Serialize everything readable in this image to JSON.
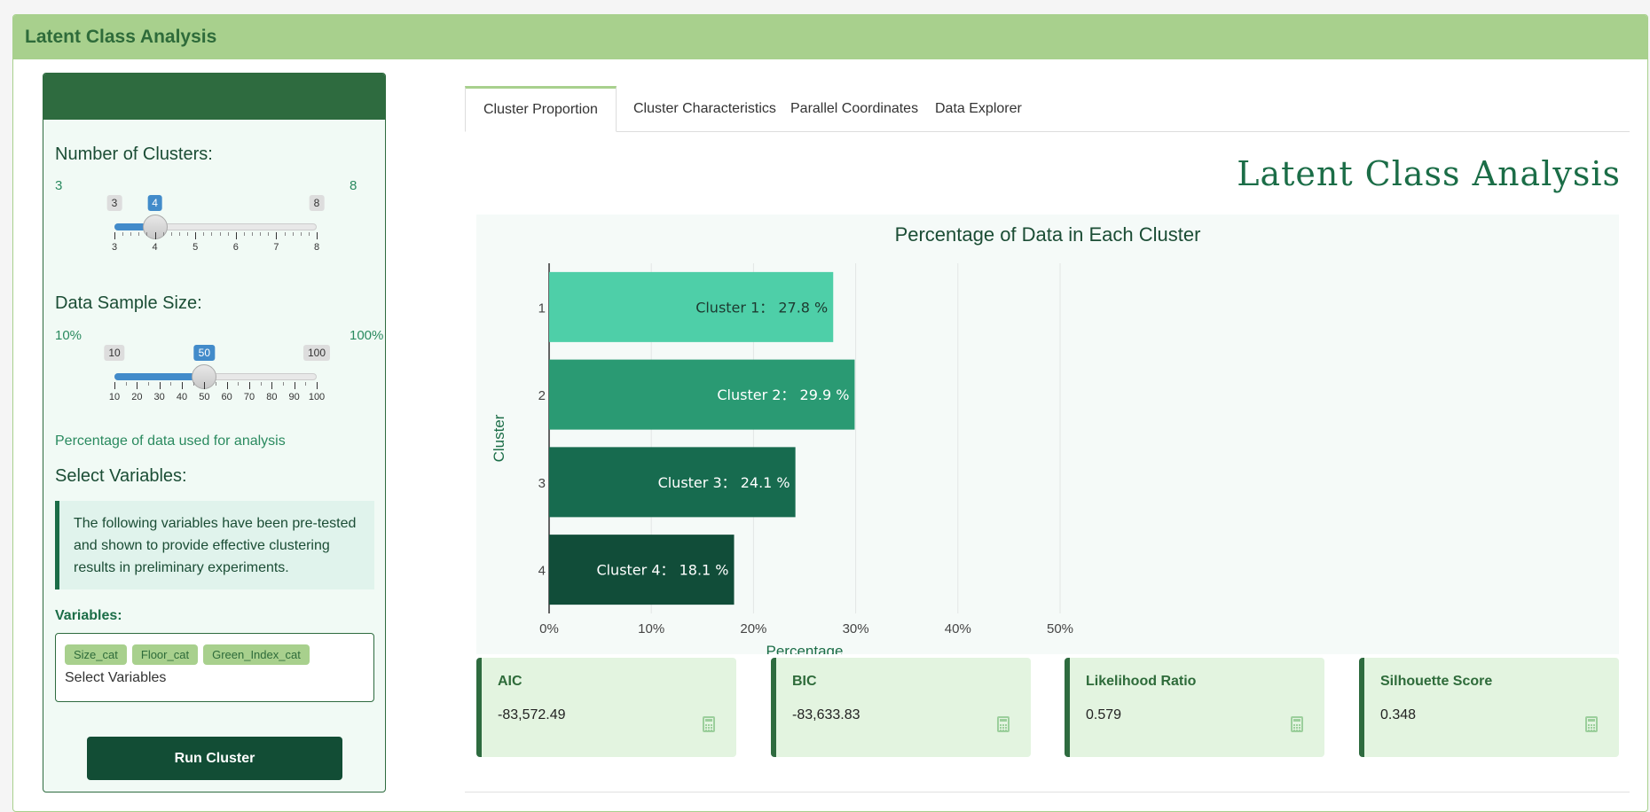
{
  "header": {
    "title": "Latent Class Analysis"
  },
  "sidebar": {
    "clusters": {
      "label": "Number of Clusters:",
      "min_label": "3",
      "max_label": "8",
      "min": 3,
      "max": 8,
      "value": 4,
      "bubble_min": "3",
      "bubble_max": "8",
      "bubble_value": "4",
      "ticks": [
        "3",
        "4",
        "5",
        "6",
        "7",
        "8"
      ]
    },
    "sample": {
      "label": "Data Sample Size:",
      "min_label": "10%",
      "max_label": "100%",
      "min": 10,
      "max": 100,
      "value": 50,
      "bubble_min": "10",
      "bubble_max": "100",
      "bubble_value": "50",
      "ticks": [
        "10",
        "20",
        "30",
        "40",
        "50",
        "60",
        "70",
        "80",
        "90",
        "100"
      ],
      "help": "Percentage of data used for analysis"
    },
    "select_variables_label": "Select Variables:",
    "note": "The following variables have been pre-tested and shown to provide effective clustering results in preliminary experiments.",
    "variables_label": "Variables:",
    "chips": [
      "Size_cat",
      "Floor_cat",
      "Green_Index_cat"
    ],
    "variables_placeholder": "Select Variables",
    "run_button": "Run Cluster"
  },
  "tabs": [
    {
      "label": "Cluster Proportion",
      "active": true
    },
    {
      "label": "Cluster Characteristics",
      "active": false
    },
    {
      "label": "Parallel Coordinates",
      "active": false
    },
    {
      "label": "Data Explorer",
      "active": false
    }
  ],
  "main": {
    "title": "Latent Class Analysis"
  },
  "chart_data": {
    "type": "bar",
    "orientation": "horizontal",
    "title": "Percentage of Data in Each Cluster",
    "xlabel": "Percentage",
    "ylabel": "Cluster",
    "categories": [
      "1",
      "2",
      "3",
      "4"
    ],
    "values": [
      27.8,
      29.9,
      24.1,
      18.1
    ],
    "bar_labels": [
      "Cluster 1： 27.8 %",
      "Cluster 2： 29.9 %",
      "Cluster 3： 24.1 %",
      "Cluster 4： 18.1 %"
    ],
    "colors": [
      "#4ecfa8",
      "#2a9a73",
      "#176b4f",
      "#114d39"
    ],
    "xlim": [
      0,
      50
    ],
    "xticks": [
      "0%",
      "10%",
      "20%",
      "30%",
      "40%",
      "50%"
    ],
    "grid": true
  },
  "metrics": [
    {
      "title": "AIC",
      "value": "-83,572.49",
      "icon": "calculator-icon"
    },
    {
      "title": "BIC",
      "value": "-83,633.83",
      "icon": "calculator-icon"
    },
    {
      "title": "Likelihood Ratio",
      "value": "0.579",
      "icon": "calculator-icon"
    },
    {
      "title": "Silhouette Score",
      "value": "0.348",
      "icon": "calculator-icon"
    }
  ]
}
